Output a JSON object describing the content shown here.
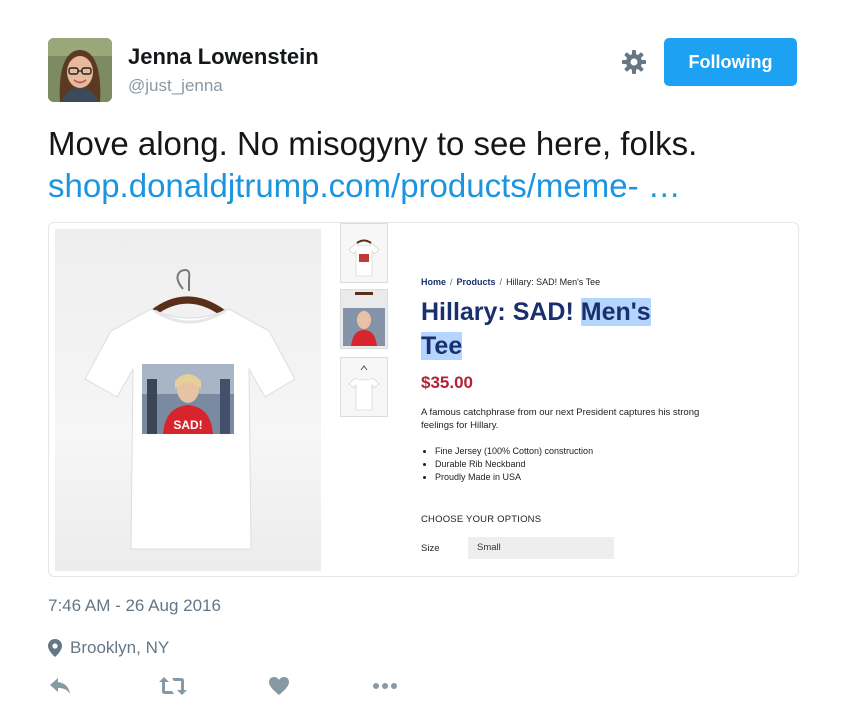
{
  "author": {
    "name": "Jenna Lowenstein",
    "handle": "@just_jenna",
    "avatar_icon": "user-avatar"
  },
  "header": {
    "follow_label": "Following",
    "gear_icon": "gear-icon"
  },
  "tweet": {
    "text": "Move along. No misogyny to see here, folks.",
    "link_text": "shop.donaldjtrump.com/products/meme- …"
  },
  "card": {
    "shirt_caption": "SAD!",
    "breadcrumb": [
      "Home",
      "Products",
      "Hillary: SAD! Men's Tee"
    ],
    "title_plain": "Hillary: SAD! ",
    "title_highlighted_1": "Men's",
    "title_highlighted_2": "Tee",
    "price": "$35.00",
    "description": "A famous catchphrase from our next President captures his strong feelings for Hillary.",
    "features": [
      "Fine Jersey (100% Cotton) construction",
      "Durable Rib Neckband",
      "Proudly Made in USA"
    ],
    "options_label": "CHOOSE YOUR OPTIONS",
    "size_label": "Size",
    "size_value": "Small"
  },
  "meta": {
    "timestamp": "7:46 AM - 26 Aug 2016",
    "location": "Brooklyn, NY"
  },
  "actions": [
    "reply-icon",
    "retweet-icon",
    "like-icon",
    "more-icon"
  ],
  "colors": {
    "accent": "#1da1f2",
    "link": "#1b95e0",
    "muted": "#657786",
    "product_navy": "#1a2f6e",
    "price_red": "#b22234",
    "highlight": "#b4d5fe"
  }
}
